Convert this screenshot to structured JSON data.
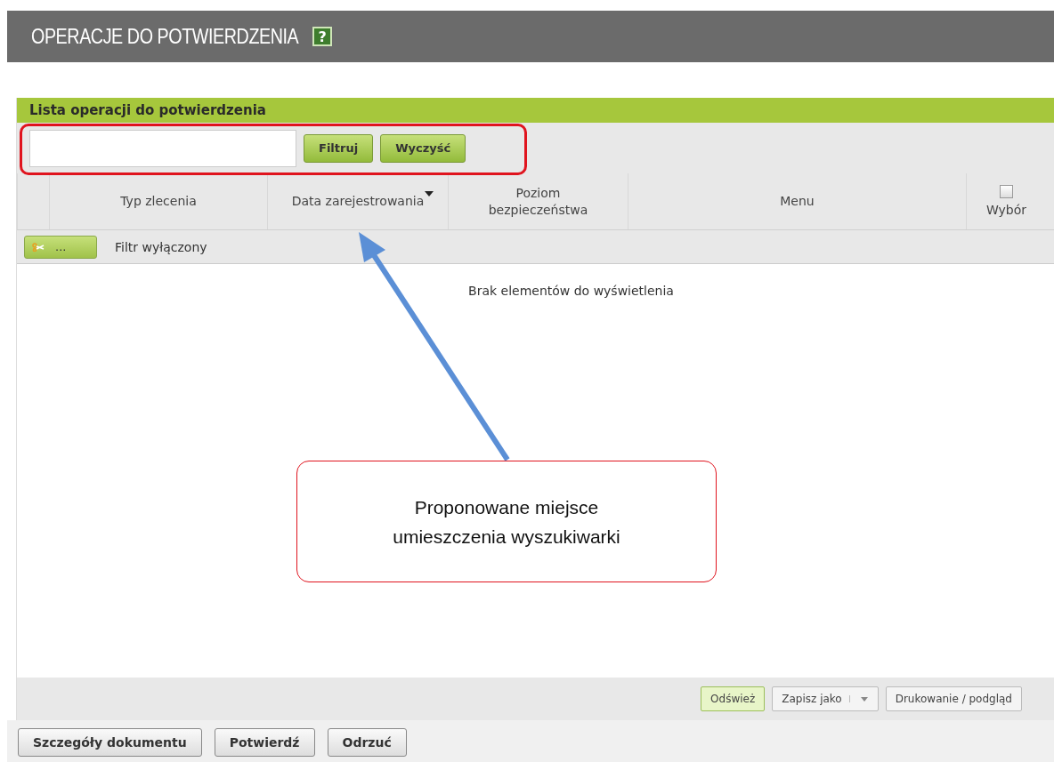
{
  "page": {
    "title": "OPERACJE DO POTWIERDZENIA",
    "help": "?"
  },
  "panel": {
    "title": "Lista operacji do potwierdzenia",
    "filter_buttons": [
      "Filtruj",
      "Wyczyść"
    ],
    "columns": [
      {
        "kind": "text",
        "label": "Typ zlecenia",
        "sorted": false
      },
      {
        "kind": "text",
        "label": "Data zarejestrowania",
        "sorted": true
      },
      {
        "kind": "text",
        "label": "Poziom bezpieczeństwa",
        "sorted": false
      },
      {
        "kind": "text",
        "label": "Menu",
        "sorted": false
      },
      {
        "kind": "checkbox",
        "label": "Wybór",
        "checked": false
      }
    ],
    "filter_toggle": "...",
    "filter_status": "Filtr wyłączony",
    "empty_message": "Brak elementów do wyświetlenia",
    "toolbar": [
      {
        "kind": "button",
        "label": "Odśwież",
        "highlighted": true
      },
      {
        "kind": "split",
        "label": "Zapisz jako",
        "highlighted": false
      },
      {
        "kind": "button",
        "label": "Drukowanie / podgląd",
        "highlighted": false
      }
    ]
  },
  "actions": [
    "Szczegóły dokumentu",
    "Potwierdź",
    "Odrzuć"
  ],
  "annotation": {
    "text": "Proponowane miejsce umieszczenia wyszukiwarki"
  }
}
